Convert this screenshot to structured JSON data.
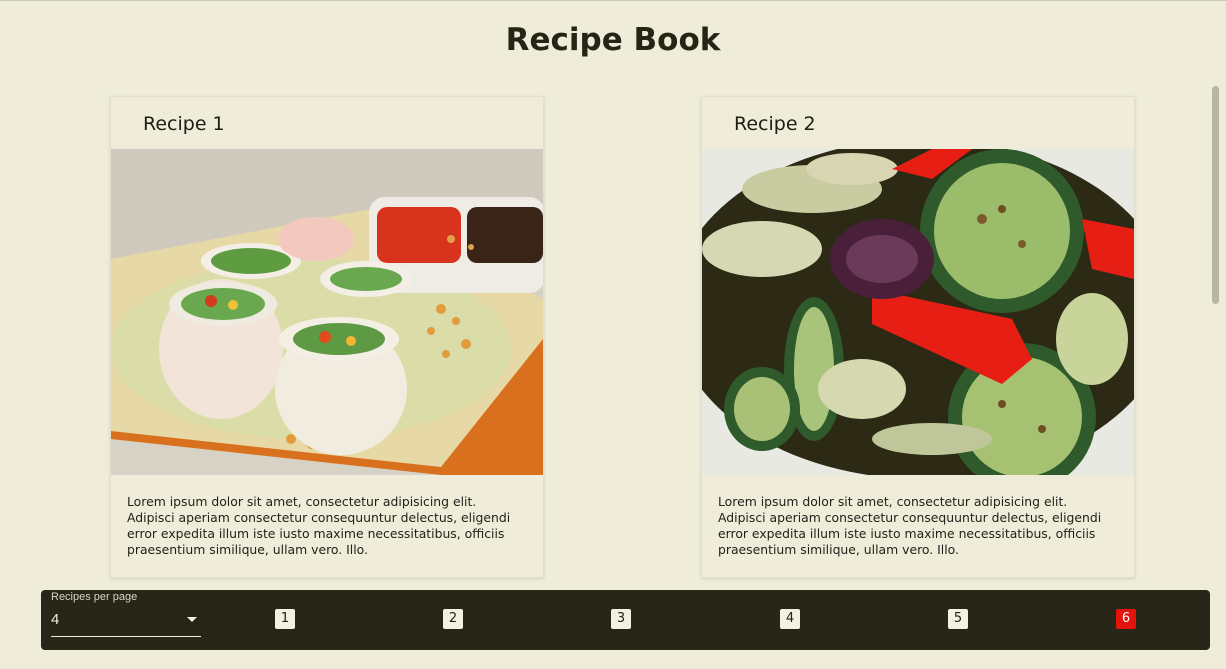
{
  "header": {
    "title": "Recipe Book"
  },
  "recipes": [
    {
      "title": "Recipe 1",
      "description": "Lorem ipsum dolor sit amet, consectetur adipisicing elit. Adipisci aperiam consectetur consequuntur delectus, eligendi error expedita illum iste iusto maxime necessitatibus, officiis praesentium similique, ullam vero. Illo."
    },
    {
      "title": "Recipe 2",
      "description": "Lorem ipsum dolor sit amet, consectetur adipisicing elit. Adipisci aperiam consectetur consequuntur delectus, eligendi error expedita illum iste iusto maxime necessitatibus, officiis praesentium similique, ullam vero. Illo."
    }
  ],
  "pagination": {
    "per_page_label": "Recipes per page",
    "per_page_value": "4",
    "pages": [
      "1",
      "2",
      "3",
      "4",
      "5",
      "6"
    ],
    "active_page": "6"
  },
  "colors": {
    "background": "#efedda",
    "footer": "#282619",
    "active_page": "#e3140b"
  }
}
